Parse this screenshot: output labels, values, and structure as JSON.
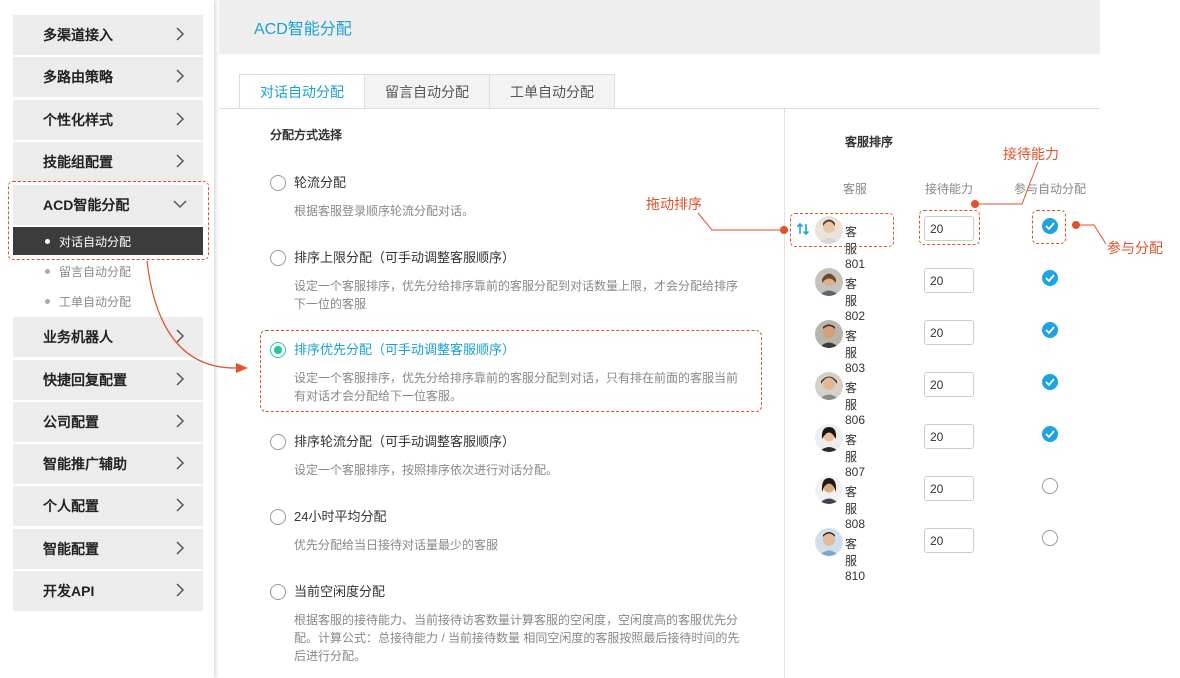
{
  "sidebar": {
    "items": [
      {
        "label": "多渠道接入"
      },
      {
        "label": "多路由策略"
      },
      {
        "label": "个性化样式"
      },
      {
        "label": "技能组配置"
      },
      {
        "label": "ACD智能分配"
      },
      {
        "label": "业务机器人"
      },
      {
        "label": "快捷回复配置"
      },
      {
        "label": "公司配置"
      },
      {
        "label": "智能推广辅助"
      },
      {
        "label": "个人配置"
      },
      {
        "label": "智能配置"
      },
      {
        "label": "开发API"
      }
    ],
    "sub_items": [
      {
        "label": "对话自动分配"
      },
      {
        "label": "留言自动分配"
      },
      {
        "label": "工单自动分配"
      }
    ]
  },
  "header": {
    "title": "ACD智能分配"
  },
  "tabs": [
    {
      "label": "对话自动分配"
    },
    {
      "label": "留言自动分配"
    },
    {
      "label": "工单自动分配"
    }
  ],
  "allocation": {
    "title": "分配方式选择",
    "options": [
      {
        "title": "轮流分配",
        "desc": "根据客服登录顺序轮流分配对话。",
        "selected": false
      },
      {
        "title": "排序上限分配（可手动调整客服顺序）",
        "desc": "设定一个客服排序，优先分给排序靠前的客服分配到对话数量上限，才会分配给排序下一位的客服",
        "selected": false
      },
      {
        "title": "排序优先分配（可手动调整客服顺序）",
        "desc": "设定一个客服排序，优先分给排序靠前的客服分配到对话，只有排在前面的客服当前有对话才会分配给下一位客服。",
        "selected": true
      },
      {
        "title": "排序轮流分配（可手动调整客服顺序）",
        "desc": "设定一个客服排序，按照排序依次进行对话分配。",
        "selected": false
      },
      {
        "title": "24小时平均分配",
        "desc": "优先分配给当日接待对话量最少的客服",
        "selected": false
      },
      {
        "title": "当前空闲度分配",
        "desc": "根据客服的接待能力、当前接待访客数量计算客服的空闲度，空闲度高的客服优先分配。计算公式：总接待能力 / 当前接待数量 相同空闲度的客服按照最后接待时间的先后进行分配。",
        "selected": false
      }
    ]
  },
  "agents": {
    "title": "客服排序",
    "columns": {
      "agent": "客服",
      "capacity": "接待能力",
      "auto": "参与自动分配"
    },
    "rows": [
      {
        "name": "客服801",
        "capacity": "20",
        "auto": true
      },
      {
        "name": "客服802",
        "capacity": "20",
        "auto": true
      },
      {
        "name": "客服803",
        "capacity": "20",
        "auto": true
      },
      {
        "name": "客服806",
        "capacity": "20",
        "auto": true
      },
      {
        "name": "客服807",
        "capacity": "20",
        "auto": true
      },
      {
        "name": "客服808",
        "capacity": "20",
        "auto": false
      },
      {
        "name": "客服810",
        "capacity": "20",
        "auto": false
      }
    ]
  },
  "annotations": {
    "drag_sort": "拖动排序",
    "capacity": "接待能力",
    "participate": "参与分配"
  },
  "colors": {
    "accent": "#1aa0d6",
    "annotation": "#e0522b",
    "radio_selected": "#1dc9a0",
    "check": "#1da3e0"
  }
}
